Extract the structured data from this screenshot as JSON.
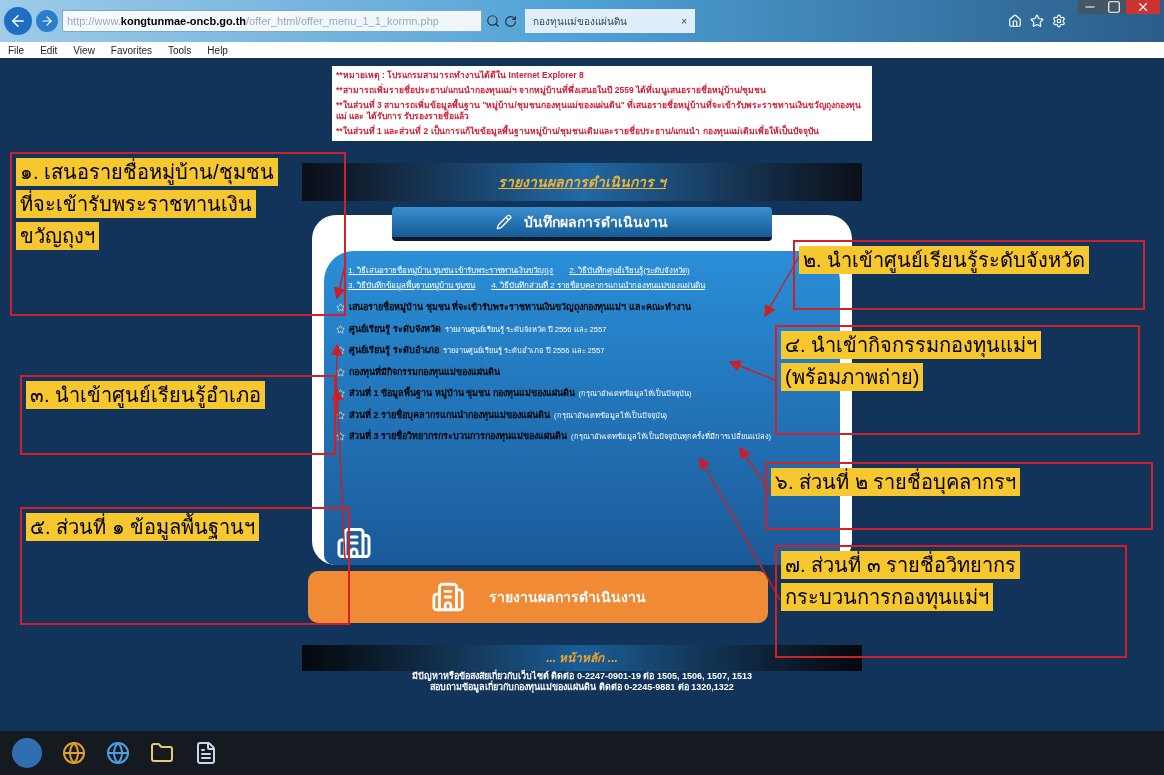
{
  "browser": {
    "url_host": "kongtunmae-oncb.go.th",
    "url_prefix": "http://www.",
    "url_path": "/offer_html/offer_menu_1_1_kormn.php",
    "tab_title": "กองทุนแม่ของแผ่นดิน",
    "tab_close": "×",
    "menu": [
      "File",
      "Edit",
      "View",
      "Favorites",
      "Tools",
      "Help"
    ]
  },
  "notice": [
    "**หมายเหตุ : โปรแกรมสามารถทำงานได้ดีใน Internet Explorer 8",
    "**สามารถเพิ่มรายชื่อประธาน/แกนนำกองทุนแม่ฯ จากหมู่บ้านที่พึ่งเสนอในปี 2559 ได้ที่เมนูเสนอรายชื่อหมู่บ้าน/ชุมชน",
    "**ในส่วนที่ 3 สามารถเพิ่มข้อมูลพื้นฐาน \"หมู่บ้าน/ชุมชนกองทุนแม่ของแผ่นดิน\" ที่เสนอรายชื่อหมู่บ้านที่จะเข้ารับพระราชทานเงินขวัญถุงกองทุนแม่ และ ได้รับการ รับรองรายชื่อแล้ว",
    "**ในส่วนที่ 1 และส่วนที่ 2 เป็นการแก้ไขข้อมูลพื้นฐานหมู่บ้าน/ชุมชนเดิมและรายชื่อประธาน/แกนนำ กองทุนแม่เดิมเพื่อให้เป็นปัจจุบัน"
  ],
  "ribbon_title": "รายงานผลการดำเนินการ ฯ",
  "record_header": "บันทึกผลการดำเนินงาน",
  "help_links": [
    [
      "1. วิธีเสนอรายชื่อหมู่บ้าน ชุมชน เข้ารับพระราชทานเงินขวัญถุง",
      "2. วิธีบันทึกศูนย์เรียนรู้(ระดับจังหวัด)"
    ],
    [
      "3. วิธีบันทึกข้อมูลพื้นฐานหมู่บ้าน ชุมชน",
      "4. วิธีบันทึกส่วนที่ 2 รายชื่อบุคลากรแกนนำกองทุนแม่ของแผ่นดิน"
    ]
  ],
  "menu_items": [
    {
      "label": "เสนอรายชื่อหมู่บ้าน ชุมชน ที่จะเข้ารับพระราชทานเงินขวัญถุงกองทุนแม่ฯ และคณะทำงาน"
    },
    {
      "label": "ศูนย์เรียนรู้ ระดับจังหวัด",
      "note": "รายงานศูนย์เรียนรู้ ระดับจังหวัด ปี 2556 และ 2557"
    },
    {
      "label": "ศูนย์เรียนรู้ ระดับอำเภอ",
      "note": "รายงานศูนย์เรียนรู้ ระดับอำเภอ ปี 2556 และ 2557"
    },
    {
      "label": "กองทุนที่มีกิจกรรมกองทุนแม่ของแผ่นดิน"
    },
    {
      "label": "ส่วนที่ 1 ข้อมูลพื้นฐาน หมู่บ้าน ชุมชน กองทุนแม่ของแผ่นดิน",
      "note": "(กรุณาอัพเดทข้อมูลให้เป็นปัจจุบัน)"
    },
    {
      "label": "ส่วนที่ 2 รายชื่อบุคลากรแกนนำกองทุนแม่ของแผ่นดิน",
      "note": "(กรุณาอัพเดทข้อมูลให้เป็นปัจจุบัน)"
    },
    {
      "label": "ส่วนที่ 3 รายชื่อวิทยากรกระบวนการกองทุนแม่ของแผ่นดิน",
      "note": "(กรุณาอัพเดทข้อมูลให้เป็นปัจจุบันทุกครั้งที่มีการเปลี่ยนแปลง)"
    }
  ],
  "report_button": "รายงานผลการดำเนินงาน",
  "home_link": "... หน้าหลัก ...",
  "footer": [
    "มีปัญหาหรือข้อสงสัยเกี่ยวกับเว็บไซต์ ติดต่อ 0-2247-0901-19 ต่อ 1505, 1506, 1507, 1513",
    "สอบถามข้อมูลเกี่ยวกับกองทุนแม่ของแผ่นดิน ติดต่อ 0-2245-9881 ต่อ 1320,1322"
  ],
  "callouts": [
    {
      "lines": [
        "๑. เสนอรายชื่อหมู่บ้าน/ชุมชน",
        "ที่จะเข้ารับพระราชทานเงิน",
        "ขวัญถุงฯ"
      ]
    },
    {
      "lines": [
        "๒. นำเข้าศูนย์เรียนรู้ระดับจังหวัด"
      ]
    },
    {
      "lines": [
        "๓. นำเข้าศูนย์เรียนรู้อำเภอ"
      ]
    },
    {
      "lines": [
        "๔. นำเข้ากิจกรรมกองทุนแม่ฯ",
        "(พร้อมภาพถ่าย)"
      ]
    },
    {
      "lines": [
        "๕. ส่วนที่ ๑ ข้อมูลพื้นฐานฯ"
      ]
    },
    {
      "lines": [
        "๖. ส่วนที่ ๒ รายชื่อบุคลากรฯ"
      ]
    },
    {
      "lines": [
        "๗. ส่วนที่ ๓ รายชื่อวิทยากร",
        "กระบวนการกองทุนแม่ฯ"
      ]
    }
  ]
}
